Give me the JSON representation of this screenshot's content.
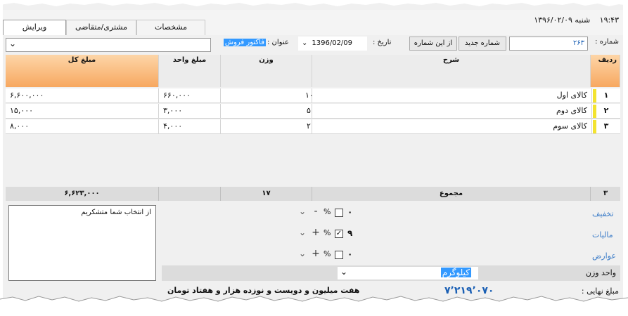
{
  "header": {
    "clock_time": "۱۹:۴۳",
    "clock_date": "شنبه ۱۳۹۶/۰۲/۰۹",
    "tabs": [
      {
        "label": "ویرایش"
      },
      {
        "label": "مشتری/متقاضی"
      },
      {
        "label": "مشخصات"
      }
    ]
  },
  "form": {
    "number_label": "شماره :",
    "number_value": "۲۶۳",
    "new_number_button": "شماره جدید",
    "from_number_button": "از این شماره",
    "date_label": "تاریخ :",
    "date_value": "1396/02/09",
    "title_label": "عنوان :",
    "title_value": "فاکتور فروش"
  },
  "grid": {
    "columns": {
      "row": "ردیف",
      "desc": "شرح",
      "weight": "وزن",
      "unit_price": "مبلغ واحد",
      "total": "مبلغ کل"
    },
    "rows": [
      {
        "num": "۱",
        "desc": "کالای اول",
        "weight": "۱۰",
        "unit_price": "۶۶۰,۰۰۰",
        "total": "۶,۶۰۰,۰۰۰"
      },
      {
        "num": "۲",
        "desc": "کالای دوم",
        "weight": "۵",
        "unit_price": "۳,۰۰۰",
        "total": "۱۵,۰۰۰"
      },
      {
        "num": "۳",
        "desc": "کالای سوم",
        "weight": "۲",
        "unit_price": "۴,۰۰۰",
        "total": "۸,۰۰۰"
      }
    ]
  },
  "totals": {
    "count": "۳",
    "label": "مجموع",
    "weight_total": "۱۷",
    "amount_total": "۶,۶۲۳,۰۰۰"
  },
  "adjustments": {
    "discount_label": "تخفیف",
    "discount_value": "۰",
    "tax_label": "مالیات",
    "tax_value": "۹",
    "tax_checked": "✓",
    "duties_label": "عوارض",
    "duties_value": "۰",
    "percent": "%",
    "minus": "-",
    "plus": "+"
  },
  "note": {
    "text": "از انتخاب شما متشکریم"
  },
  "weight_unit": {
    "label": "واحد وزن",
    "value": "کیلوگرم"
  },
  "final": {
    "label": "مبلغ نهایی :",
    "amount": "۷٬۲۱۹٬۰۷۰",
    "words": "هفت میلیون و دویست و نوزده هزار و هفتاد تومان"
  },
  "colors": {
    "accent_header": "#f7a860",
    "marker": "#f3e330",
    "link_label": "#3a7bc8",
    "final_amount": "#1a5fb4",
    "selection": "#3399ff"
  }
}
